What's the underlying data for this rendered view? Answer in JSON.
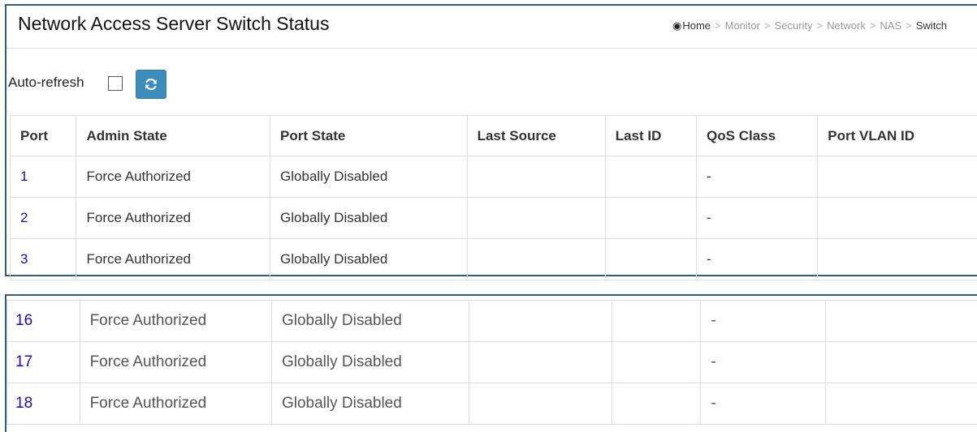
{
  "header": {
    "title": "Network Access Server Switch Status",
    "breadcrumb": [
      "Home",
      "Monitor",
      "Security",
      "Network",
      "NAS",
      "Switch"
    ]
  },
  "controls": {
    "auto_refresh_label": "Auto-refresh",
    "auto_refresh_checked": false,
    "refresh_button_icon": "refresh-icon"
  },
  "table": {
    "columns": [
      "Port",
      "Admin State",
      "Port State",
      "Last Source",
      "Last ID",
      "QoS Class",
      "Port VLAN ID"
    ],
    "rows_top": [
      {
        "port": "1",
        "admin_state": "Force Authorized",
        "port_state": "Globally Disabled",
        "last_source": "",
        "last_id": "",
        "qos_class": "-",
        "port_vlan_id": ""
      },
      {
        "port": "2",
        "admin_state": "Force Authorized",
        "port_state": "Globally Disabled",
        "last_source": "",
        "last_id": "",
        "qos_class": "-",
        "port_vlan_id": ""
      },
      {
        "port": "3",
        "admin_state": "Force Authorized",
        "port_state": "Globally Disabled",
        "last_source": "",
        "last_id": "",
        "qos_class": "-",
        "port_vlan_id": ""
      }
    ],
    "rows_bottom": [
      {
        "port": "16",
        "admin_state": "Force Authorized",
        "port_state": "Globally Disabled",
        "last_source": "",
        "last_id": "",
        "qos_class": "-",
        "port_vlan_id": ""
      },
      {
        "port": "17",
        "admin_state": "Force Authorized",
        "port_state": "Globally Disabled",
        "last_source": "",
        "last_id": "",
        "qos_class": "-",
        "port_vlan_id": ""
      },
      {
        "port": "18",
        "admin_state": "Force Authorized",
        "port_state": "Globally Disabled",
        "last_source": "",
        "last_id": "",
        "qos_class": "-",
        "port_vlan_id": ""
      }
    ]
  },
  "colors": {
    "panel_border": "#2f5d83",
    "button_bg": "#3c8dbc",
    "link": "#1a0dbf"
  }
}
